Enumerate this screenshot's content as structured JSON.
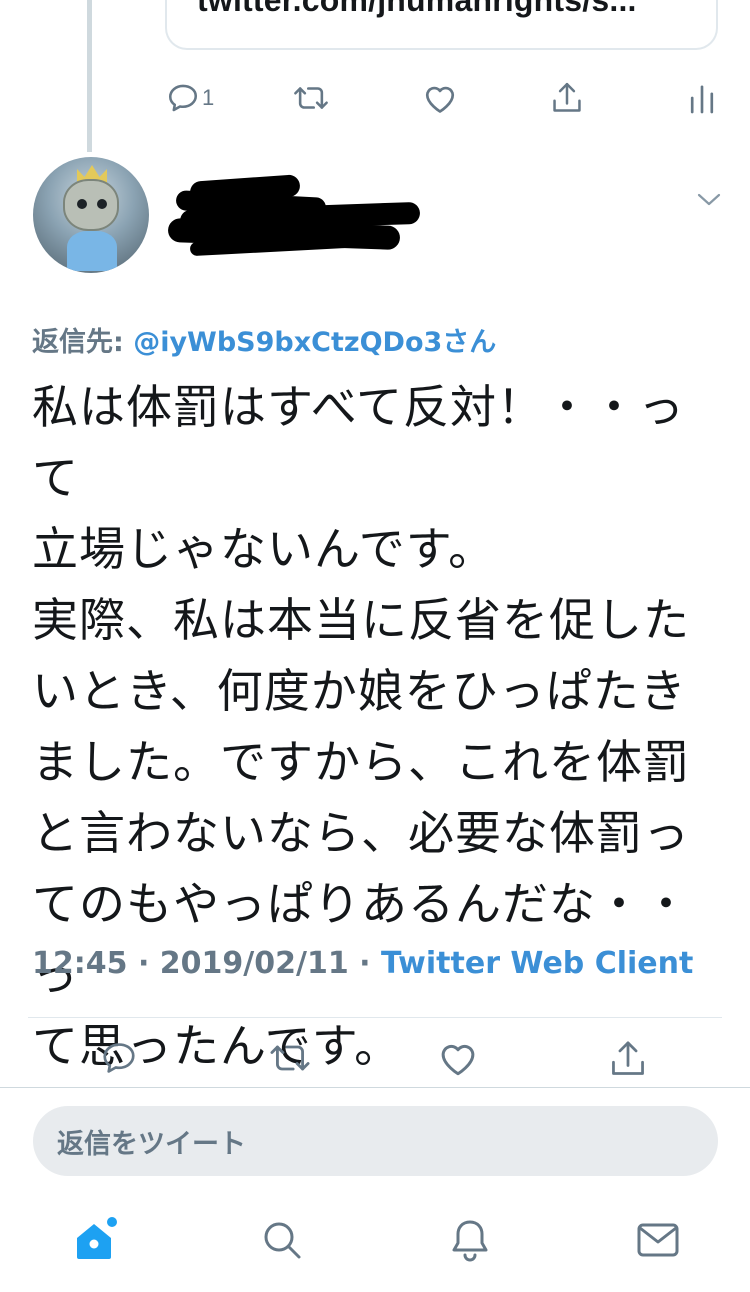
{
  "previous_tweet": {
    "link_card_text": "twitter.com/jhumanrights/s...",
    "reply_count": "1"
  },
  "tweet": {
    "reply_to_label": "返信先: ",
    "reply_to_handle": "@iyWbS9bxCtzQDo3さん",
    "text": "私は体罰はすべて反対！・・って\n立場じゃないんです。\n実際、私は本当に反省を促した\nいとき、何度か娘をひっぱたき\nました。ですから、これを体罰\nと言わないなら、必要な体罰っ\nてのもやっぱりあるんだな・・っ\nて思ったんです。",
    "time": "12:45",
    "date": "2019/02/11",
    "separator": " · ",
    "client": "Twitter Web Client"
  },
  "reply_box": {
    "placeholder": "返信をツイート"
  },
  "icons": [
    "reply-icon",
    "retweet-icon",
    "like-icon",
    "share-icon",
    "analytics-icon",
    "chevron-down-icon",
    "home-icon",
    "search-icon",
    "notifications-icon",
    "messages-icon"
  ],
  "colors": {
    "accent": "#1da1f2",
    "link": "#3b8fd6",
    "secondary_text": "#657786",
    "icon": "#657786"
  }
}
